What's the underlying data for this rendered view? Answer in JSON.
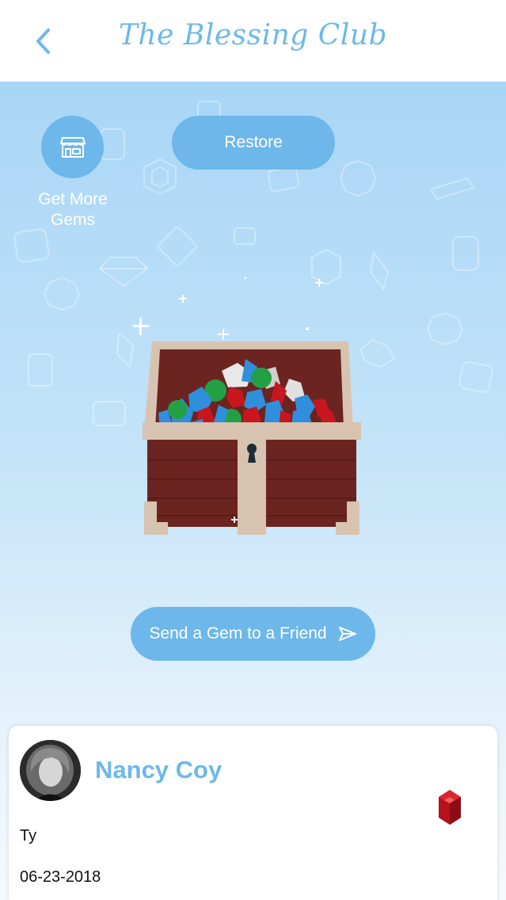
{
  "header": {
    "title": "The Blessing Club",
    "back_icon": "chevron-left-icon"
  },
  "colors": {
    "accent": "#6cb9e8",
    "button": "#6db7ea",
    "chest_wood": "#7a2b26",
    "chest_trim": "#d8c3b0"
  },
  "store": {
    "icon": "storefront-icon",
    "label_line1": "Get More",
    "label_line2": "Gems"
  },
  "restore": {
    "label": "Restore"
  },
  "send": {
    "label": "Send a Gem to a Friend",
    "icon": "send-arrow-icon"
  },
  "card": {
    "name": "Nancy Coy",
    "message": "Ty",
    "date": "06-23-2018",
    "gem_icon": "red-gem-icon"
  }
}
